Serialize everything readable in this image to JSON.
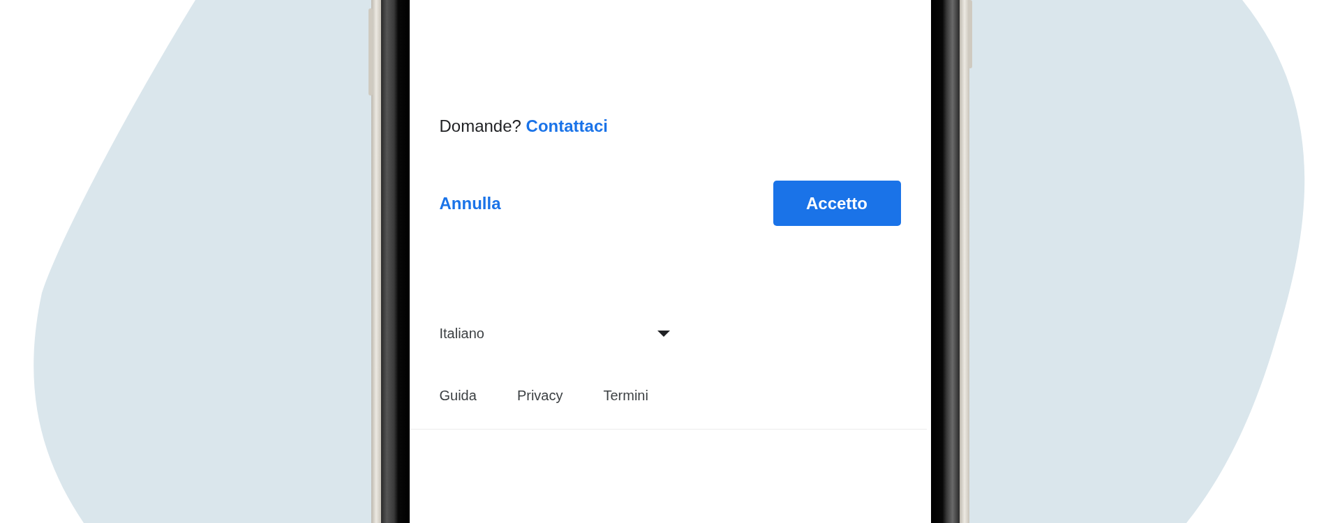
{
  "contact": {
    "question": "Domande?",
    "link": "Contattaci"
  },
  "actions": {
    "cancel": "Annulla",
    "accept": "Accetto"
  },
  "language": {
    "value": "Italiano"
  },
  "footer_links": [
    "Guida",
    "Privacy",
    "Termini"
  ]
}
